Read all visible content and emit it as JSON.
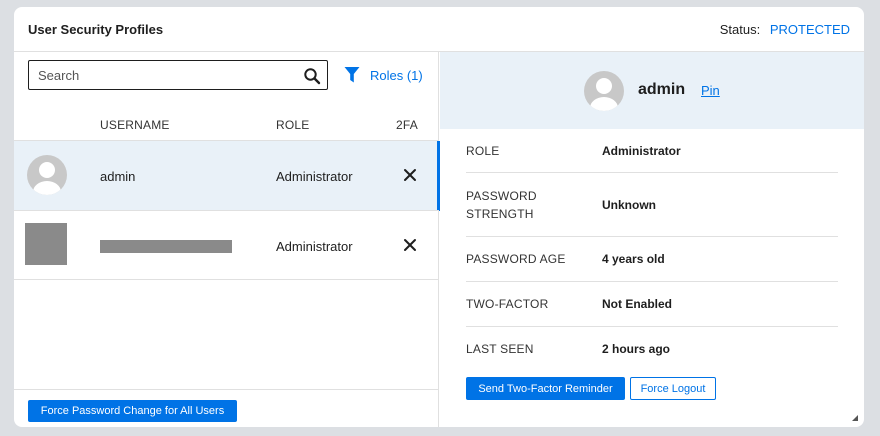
{
  "header": {
    "title": "User Security Profiles",
    "status_label": "Status:",
    "status_value": "PROTECTED"
  },
  "search": {
    "placeholder": "Search",
    "value": ""
  },
  "filter": {
    "roles_label": "Roles (1)"
  },
  "table": {
    "columns": [
      "USERNAME",
      "ROLE",
      "2FA"
    ],
    "rows": [
      {
        "username": "admin",
        "role": "Administrator",
        "two_factor": "✕"
      },
      {
        "username": "",
        "role": "Administrator",
        "two_factor": "✕"
      }
    ]
  },
  "footer": {
    "force_all_label": "Force Password Change for All Users"
  },
  "profile": {
    "name": "admin",
    "pin_label": "Pin",
    "details": [
      {
        "label": "ROLE",
        "value": "Administrator"
      },
      {
        "label": "PASSWORD STRENGTH",
        "value": "Unknown"
      },
      {
        "label": "PASSWORD AGE",
        "value": "4 years old"
      },
      {
        "label": "TWO-FACTOR",
        "value": "Not Enabled"
      },
      {
        "label": "LAST SEEN",
        "value": "2 hours ago"
      }
    ],
    "send_reminder_label": "Send Two-Factor Reminder",
    "force_logout_label": "Force Logout"
  },
  "colors": {
    "accent": "#0073e6",
    "selected_row": "#e9f1f8",
    "background": "#dcdfe3"
  },
  "icons": [
    "search-icon",
    "filter-icon",
    "user-avatar-icon",
    "close-x-icon",
    "resize-handle-icon"
  ]
}
